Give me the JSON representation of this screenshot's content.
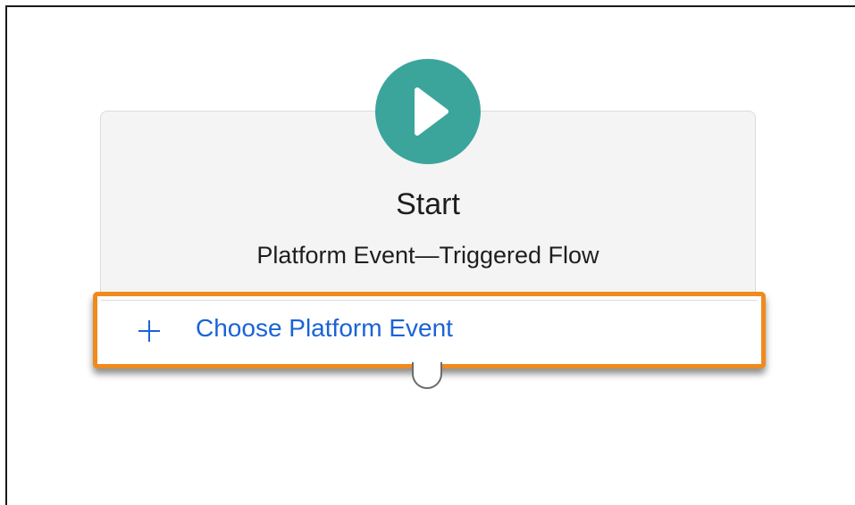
{
  "start_node": {
    "title": "Start",
    "subtitle": "Platform Event—Triggered Flow",
    "icon": "play-icon",
    "accent_color": "#3ba59c"
  },
  "choose_event": {
    "label": "Choose Platform Event",
    "icon": "plus-icon",
    "highlight_color": "#f08a1c",
    "link_color": "#1a63d6"
  },
  "connector": {
    "icon": "connector-circle-icon"
  }
}
